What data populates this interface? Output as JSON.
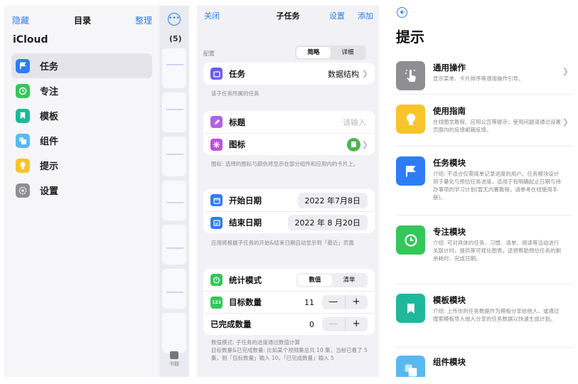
{
  "sidebar": {
    "hide": "隐藏",
    "title": "目录",
    "organize": "整理",
    "account": "iCloud",
    "badge": "(5)",
    "lock_label": "书籍",
    "items": [
      {
        "label": "任务",
        "icon": "flag-icon",
        "color": "#2f7cf6",
        "active": true
      },
      {
        "label": "专注",
        "icon": "clock-icon",
        "color": "#34c759"
      },
      {
        "label": "模板",
        "icon": "bookmark-icon",
        "color": "#1fb89a"
      },
      {
        "label": "组件",
        "icon": "widget-icon",
        "color": "#58b9f0"
      },
      {
        "label": "提示",
        "icon": "bulb-icon",
        "color": "#f7c52b"
      },
      {
        "label": "设置",
        "icon": "gear-icon",
        "color": "#8e8e93"
      }
    ]
  },
  "subtask": {
    "close": "关闭",
    "title": "子任务",
    "settings": "设置",
    "add": "添加",
    "config": {
      "label": "配置",
      "seg": [
        "简略",
        "详细"
      ],
      "task_label": "任务",
      "task_value": "数据结构",
      "task_note": "该子任务所属的任务"
    },
    "basic": {
      "title_label": "标题",
      "title_placeholder": "请输入",
      "icon_label": "图标",
      "note": "图标: 选择的图标与颜色将显示在部分组件和应用内的卡片上。"
    },
    "dates": {
      "start_label": "开始日期",
      "start_value": "2022 年7月8日",
      "end_label": "结束日期",
      "end_value": "2022 年 8 月20日",
      "note": "应用将根据子任务的开始&结束日期自动显示到「最近」页面"
    },
    "stats": {
      "mode_label": "统计模式",
      "seg": [
        "数值",
        "清单"
      ],
      "target_label": "目标数量",
      "target_value": "11",
      "done_label": "已完成数量",
      "done_value": "0",
      "minus": "—",
      "plus": "+",
      "note": "数值模式: 子任务的进度通过数值计算\n目标数量&已完成数量: 比如某个视频集总共 10 集，当前已看了 5 集，则「目标数量」输入 10，「已完成数量」输入 5"
    }
  },
  "tips": {
    "title": "提示",
    "items": [
      {
        "title": "通用操作",
        "desc": "显示菜单、卡片排序等通用操作引导。",
        "color": "#8e8e93",
        "icon": "hand-tap-icon"
      },
      {
        "title": "使用指南",
        "desc": "在线图文教程、应用公告等提示；使用问题请通过设置页面内的反馈邮箱反馈。",
        "color": "#f7c52b",
        "icon": "bulb-icon"
      },
      {
        "title": "任务模块",
        "desc": "介绍: 不适合仅需简单记录进度的用户。任务模块设计用于量化与预估任务进度，适用于有明确起止日期与待办事项的学习计划(暂无内置教程，请参考在线使用手册)。",
        "color": "#2f7cf6",
        "icon": "flag-icon"
      },
      {
        "title": "专注模块",
        "desc": "介绍: 可对具体的任务、习惯、清单、阅读等活动进行关联计时，提供等可视化图表，还将帮助预估任务的剩余耗时、完成日期。",
        "color": "#34c759",
        "icon": "clock-icon"
      },
      {
        "title": "模板模块",
        "desc": "介绍: 上传你的任务数据作为模板分享给他人，或通过搜索模板导入他人分享的任务数据以快速生成计划。",
        "color": "#1fb89a",
        "icon": "bookmark-icon"
      },
      {
        "title": "组件模块",
        "desc": "",
        "color": "#58b9f0",
        "icon": "widget-icon"
      }
    ]
  },
  "colors": {
    "accent": "#2b7cf6",
    "purple": "#8a5cf6",
    "magenta": "#c04fe0"
  }
}
